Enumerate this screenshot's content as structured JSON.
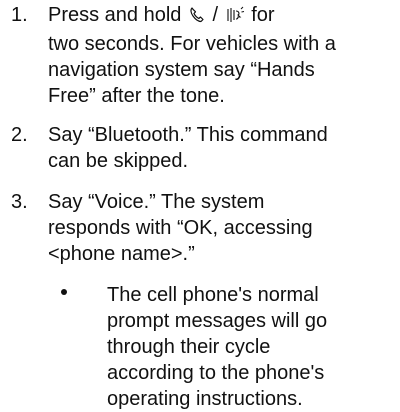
{
  "steps": [
    {
      "number": "1.",
      "line1_before_icons": "Press and hold ",
      "icon_separator": " / ",
      "line1_after_icons": " for",
      "lines_rest": [
        "two seconds. For vehicles with a",
        "navigation system say “Hands",
        "Free” after the tone."
      ],
      "icons": [
        "phone-handset-icon",
        "voice-speak-icon"
      ]
    },
    {
      "number": "2.",
      "lines": [
        "Say “Bluetooth.” This command",
        "can be skipped."
      ]
    },
    {
      "number": "3.",
      "lines": [
        "Say “Voice.” The system",
        "responds with “OK, accessing",
        "<phone name>.”"
      ]
    }
  ],
  "bullet": {
    "lines": [
      "The cell phone's normal",
      "prompt messages will go",
      "through their cycle",
      "according to the phone's",
      "operating instructions."
    ]
  }
}
